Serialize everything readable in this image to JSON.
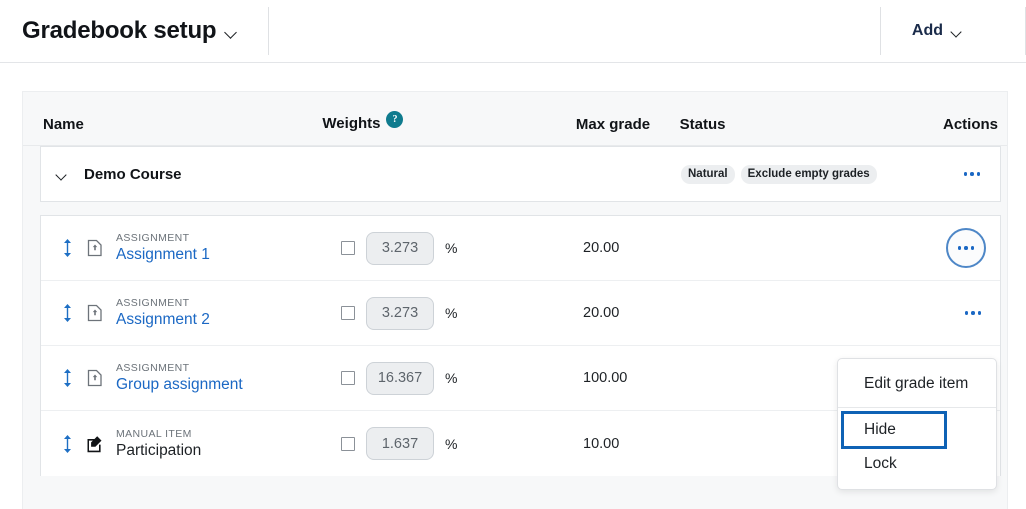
{
  "header": {
    "title": "Gradebook setup",
    "title_chevron_icon": "chevron-down-icon",
    "add_label": "Add",
    "add_chevron_icon": "chevron-down-icon"
  },
  "table": {
    "columns": {
      "name": "Name",
      "weights": "Weights",
      "weights_help_icon": "?",
      "max_grade": "Max grade",
      "status": "Status",
      "actions": "Actions"
    },
    "course": {
      "name": "Demo Course",
      "expand_icon": "chevron-down-icon",
      "badges": [
        "Natural",
        "Exclude empty grades"
      ],
      "actions_icon": "ellipsis-icon"
    },
    "rows": [
      {
        "drag_icon": "drag-vertical-icon",
        "type_icon": "assignment-icon",
        "type": "ASSIGNMENT",
        "name": "Assignment 1",
        "name_is_link": true,
        "weight_checked": false,
        "weight": "3.273",
        "percent_symbol": "%",
        "max_grade": "20.00",
        "status": "",
        "actions_icon": "ellipsis-icon",
        "actions_active": true
      },
      {
        "drag_icon": "drag-vertical-icon",
        "type_icon": "assignment-icon",
        "type": "ASSIGNMENT",
        "name": "Assignment 2",
        "name_is_link": true,
        "weight_checked": false,
        "weight": "3.273",
        "percent_symbol": "%",
        "max_grade": "20.00",
        "status": "",
        "actions_icon": "ellipsis-icon",
        "actions_active": false
      },
      {
        "drag_icon": "drag-vertical-icon",
        "type_icon": "assignment-icon",
        "type": "ASSIGNMENT",
        "name": "Group assignment",
        "name_is_link": true,
        "weight_checked": false,
        "weight": "16.367",
        "percent_symbol": "%",
        "max_grade": "100.00",
        "status": "",
        "actions_icon": "ellipsis-icon",
        "actions_active": false
      },
      {
        "drag_icon": "drag-vertical-icon",
        "type_icon": "manual-item-icon",
        "type": "MANUAL ITEM",
        "name": "Participation",
        "name_is_link": false,
        "weight_checked": false,
        "weight": "1.637",
        "percent_symbol": "%",
        "max_grade": "10.00",
        "status": "",
        "actions_icon": "ellipsis-icon",
        "actions_active": false
      }
    ]
  },
  "dropdown": {
    "items": [
      {
        "label": "Edit grade item",
        "focused": false
      },
      {
        "label": "Hide",
        "focused": true
      },
      {
        "label": "Lock",
        "focused": false
      }
    ]
  },
  "colors": {
    "accent_blue": "#1b68c4",
    "focus_blue": "#0f62b5",
    "help_teal": "#0f7b8e",
    "page_bg": "#ffffff",
    "table_bg": "#f7f8f9",
    "input_bg": "#eceef0"
  }
}
